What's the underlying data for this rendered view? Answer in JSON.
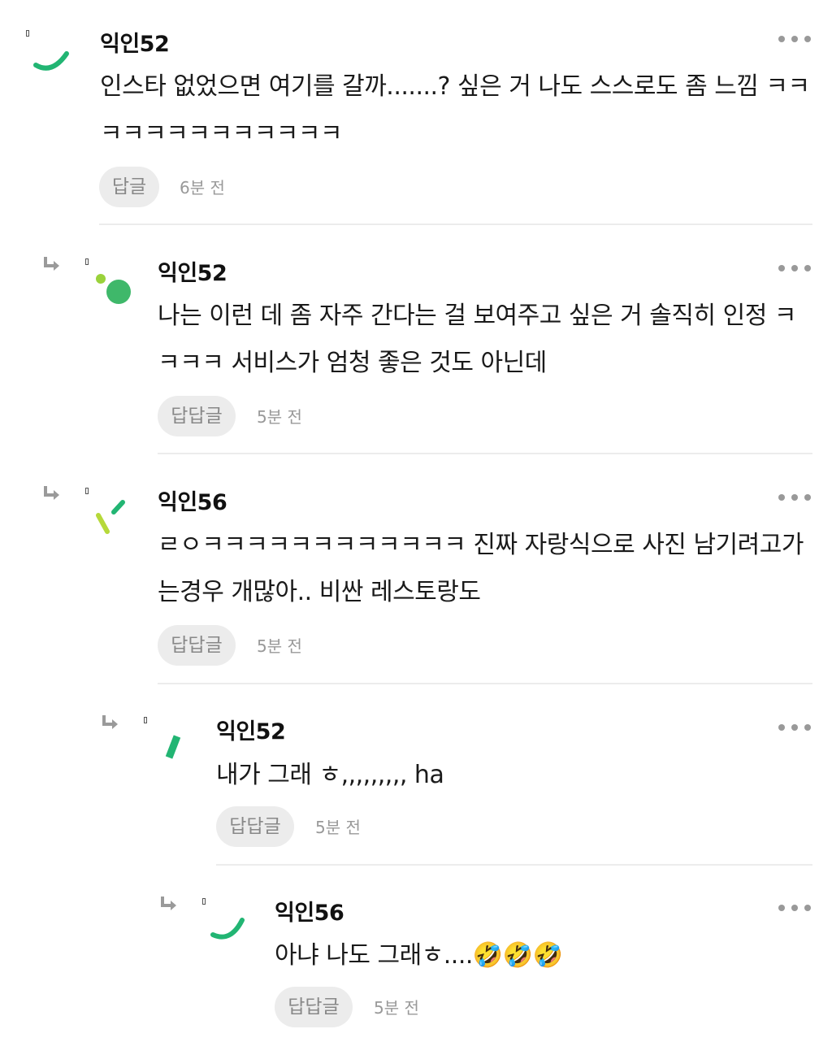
{
  "comments": [
    {
      "author": "익인52",
      "text": "인스타 없었으면 여기를 갈까.......? 싶은 거 나도 스스로도 좀 느낌 ㅋㅋㅋㅋㅋㅋㅋㅋㅋㅋㅋㅋㅋ",
      "reply_label": "답글",
      "time": "6분 전",
      "avatar_icon": "green-arc-avatar-icon"
    },
    {
      "author": "익인52",
      "text": "나는 이런 데 좀 자주 간다는 걸 보여주고 싶은 거 솔직히 인정 ㅋㅋㅋㅋ 서비스가 엄청 좋은 것도 아닌데",
      "reply_label": "답답글",
      "time": "5분 전",
      "avatar_icon": "green-dots-avatar-icon"
    },
    {
      "author": "익인56",
      "text": "ㄹㅇㅋㅋㅋㅋㅋㅋㅋㅋㅋㅋㅋㅋ 진짜 자랑식으로 사진 남기려고가는경우 개많아.. 비싼 레스토랑도",
      "reply_label": "답답글",
      "time": "5분 전",
      "avatar_icon": "green-strokes-avatar-icon"
    },
    {
      "author": "익인52",
      "text": "내가 그래 ㅎ,,,,,,,,, ha",
      "reply_label": "답답글",
      "time": "5분 전",
      "avatar_icon": "green-bar-avatar-icon"
    },
    {
      "author": "익인56",
      "text": "아냐 나도 그래ㅎ....🤣🤣🤣",
      "reply_label": "답답글",
      "time": "5분 전",
      "avatar_icon": "green-arc-avatar-icon"
    }
  ],
  "colors": {
    "accent": "#22b573",
    "lime": "#9ad23b",
    "button_bg": "#ececec"
  }
}
